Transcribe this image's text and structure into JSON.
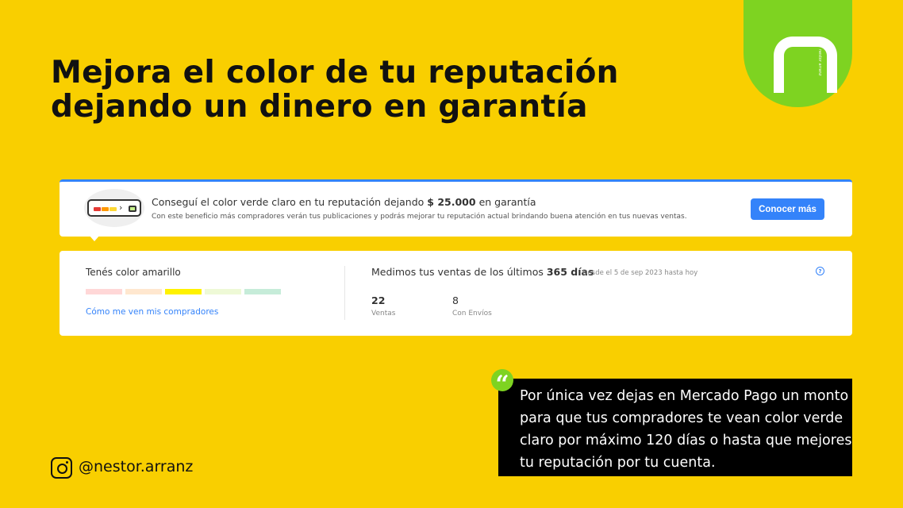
{
  "headline": {
    "line1": "Mejora el color de tu reputación",
    "line2": "dejando un dinero en garantía"
  },
  "logo": {
    "vertical_text": "nestor arranz"
  },
  "banner": {
    "title_prefix": "Conseguí el color verde claro en tu reputación dejando",
    "title_amount": "$ 25.000",
    "title_suffix": "en garantía",
    "subtitle": "Con este beneficio más compradores verán tus publicaciones y podrás mejorar tu reputación actual brindando buena atención en tus nuevas ventas.",
    "button_label": "Conocer más"
  },
  "reputation": {
    "title": "Tenés color amarillo",
    "link_label": "Cómo me ven mis compradores",
    "colors": [
      "#FFD7D7",
      "#FFE7CF",
      "#FFF200",
      "#EEF9D6",
      "#C6ECD9"
    ],
    "current_level": 3
  },
  "sales": {
    "title_prefix": "Medimos tus ventas de los últimos",
    "title_days": "365 días",
    "range": "Desde el 5 de sep 2023 hasta hoy",
    "help_symbol": "?",
    "stats": [
      {
        "value": "22",
        "label": "Ventas"
      },
      {
        "value": "8",
        "label": "Con Envíos"
      }
    ]
  },
  "quote": {
    "symbol": "“",
    "text": "Por única vez dejas en Mercado Pago un monto para que tus compradores te vean color verde claro por máximo 120 días o hasta que mejores tu reputación por tu cuenta."
  },
  "social": {
    "handle": "@nestor.arranz"
  },
  "colors": {
    "background": "#F9CF00",
    "accent_green": "#7ED321",
    "button_blue": "#3483FA"
  }
}
